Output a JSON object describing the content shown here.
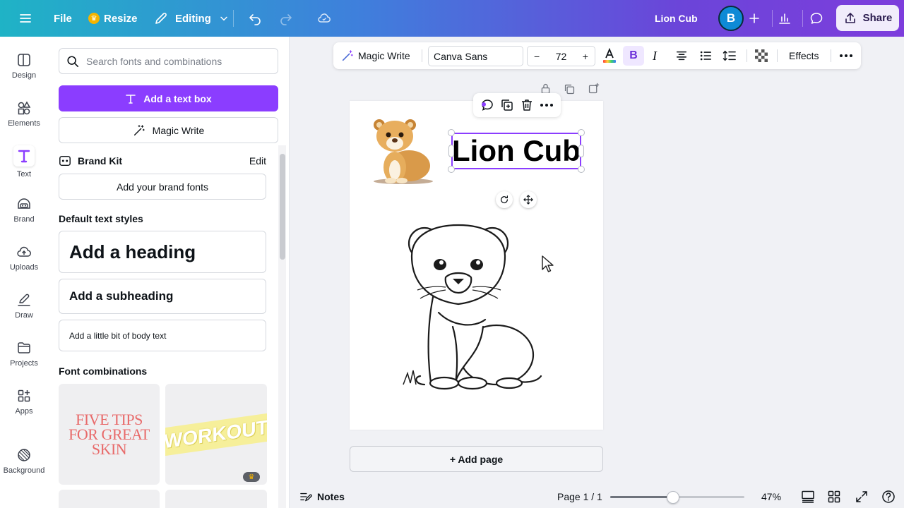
{
  "topbar": {
    "file_label": "File",
    "resize_label": "Resize",
    "editing_label": "Editing",
    "doc_title": "Lion Cub",
    "avatar_initial": "B",
    "share_label": "Share"
  },
  "rail": {
    "items": [
      {
        "label": "Design",
        "icon": "design-icon"
      },
      {
        "label": "Elements",
        "icon": "elements-icon"
      },
      {
        "label": "Text",
        "icon": "text-icon"
      },
      {
        "label": "Brand",
        "icon": "brand-icon"
      },
      {
        "label": "Uploads",
        "icon": "uploads-icon"
      },
      {
        "label": "Draw",
        "icon": "draw-icon"
      },
      {
        "label": "Projects",
        "icon": "projects-icon"
      },
      {
        "label": "Apps",
        "icon": "apps-icon"
      },
      {
        "label": "Background",
        "icon": "background-icon"
      }
    ]
  },
  "panel": {
    "search_placeholder": "Search fonts and combinations",
    "add_text_box": "Add a text box",
    "magic_write": "Magic Write",
    "brand_kit": "Brand Kit",
    "brand_edit": "Edit",
    "add_brand_fonts": "Add your brand fonts",
    "default_styles_title": "Default text styles",
    "heading": "Add a heading",
    "subheading": "Add a subheading",
    "body": "Add a little bit of body text",
    "font_combinations_title": "Font combinations",
    "combo1_text": "FIVE TIPS FOR GREAT SKIN",
    "combo2_text": "WORKOUT"
  },
  "toolbar": {
    "magic_write": "Magic Write",
    "font_name": "Canva Sans",
    "font_size": "72",
    "minus": "−",
    "plus": "+",
    "bold": "B",
    "italic": "I",
    "effects": "Effects"
  },
  "canvas": {
    "heading_text": "Lion Cub",
    "add_page": "+ Add page"
  },
  "bottombar": {
    "notes": "Notes",
    "page_indicator": "Page 1 / 1",
    "zoom": "47%",
    "zoom_fraction": 0.47
  },
  "colors": {
    "accent": "#8b3dff",
    "topbar_start": "#1fb3c6",
    "topbar_end": "#7d3ddc"
  }
}
